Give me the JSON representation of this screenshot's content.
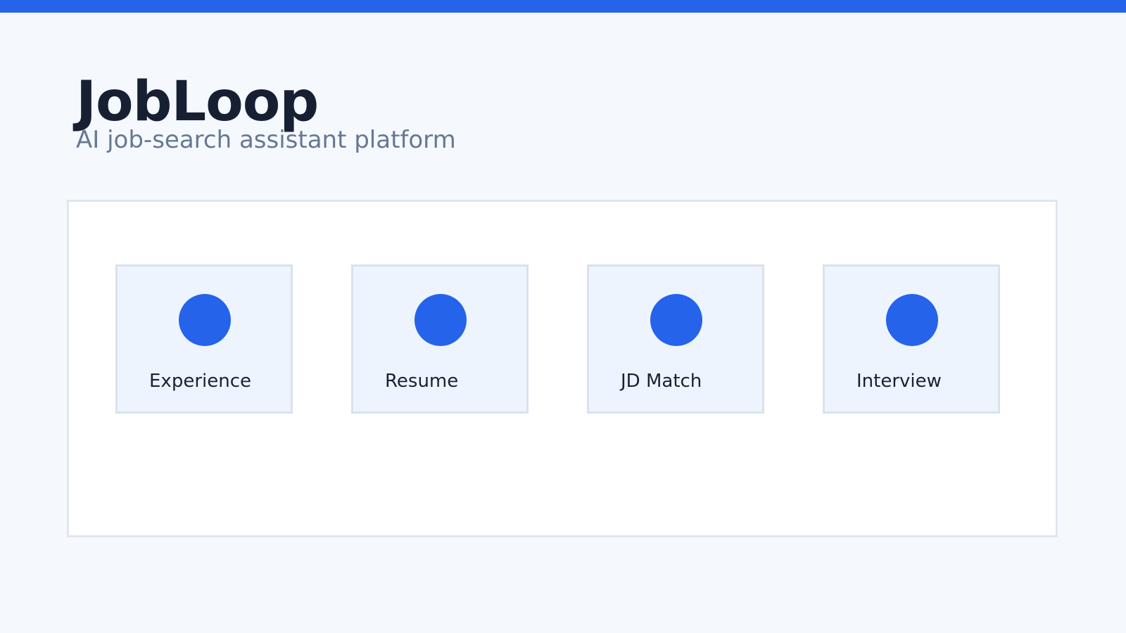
{
  "brand": {
    "title": "JobLoop",
    "subtitle": "AI job-search assistant platform"
  },
  "features": [
    {
      "label": "Experience",
      "icon": "circle-icon"
    },
    {
      "label": "Resume",
      "icon": "circle-icon"
    },
    {
      "label": "JD Match",
      "icon": "circle-icon"
    },
    {
      "label": "Interview",
      "icon": "circle-icon"
    }
  ],
  "colors": {
    "accent": "#2563eb",
    "background": "#f5f9fd",
    "panel": "#ffffff",
    "card": "#edf4fe",
    "border": "#dfe6f0",
    "title": "#172033",
    "subtitle": "#667894"
  }
}
